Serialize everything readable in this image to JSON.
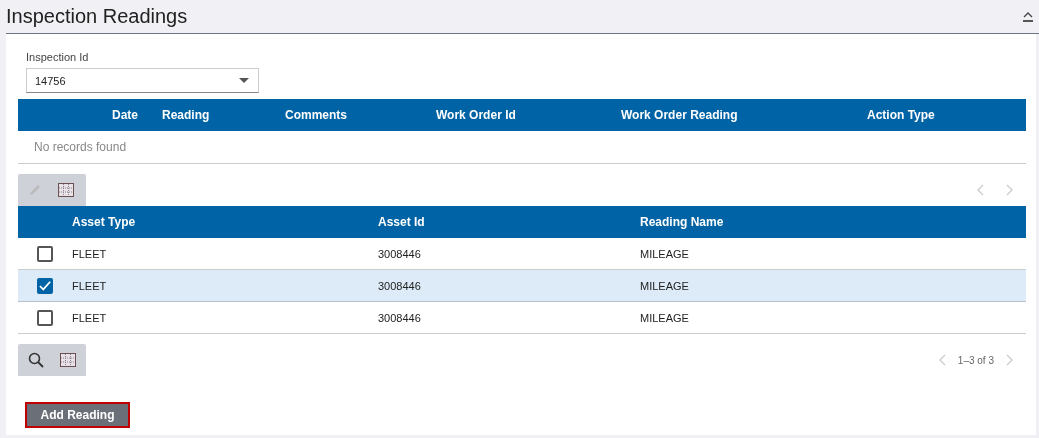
{
  "title": "Inspection Readings",
  "inspection_field": {
    "label": "Inspection Id",
    "value": "14756"
  },
  "readings_table": {
    "columns": [
      "Date",
      "Reading",
      "Comments",
      "Work Order Id",
      "Work Order Reading",
      "Action Type"
    ],
    "empty_message": "No records found"
  },
  "assets_table": {
    "columns": [
      "Asset Type",
      "Asset Id",
      "Reading Name"
    ],
    "rows": [
      {
        "cells": [
          "FLEET",
          "3008446",
          "MILEAGE"
        ],
        "selected": false
      },
      {
        "cells": [
          "FLEET",
          "3008446",
          "MILEAGE"
        ],
        "selected": true
      },
      {
        "cells": [
          "FLEET",
          "3008446",
          "MILEAGE"
        ],
        "selected": false
      }
    ],
    "pager": "1–3 of 3"
  },
  "add_button": "Add Reading"
}
